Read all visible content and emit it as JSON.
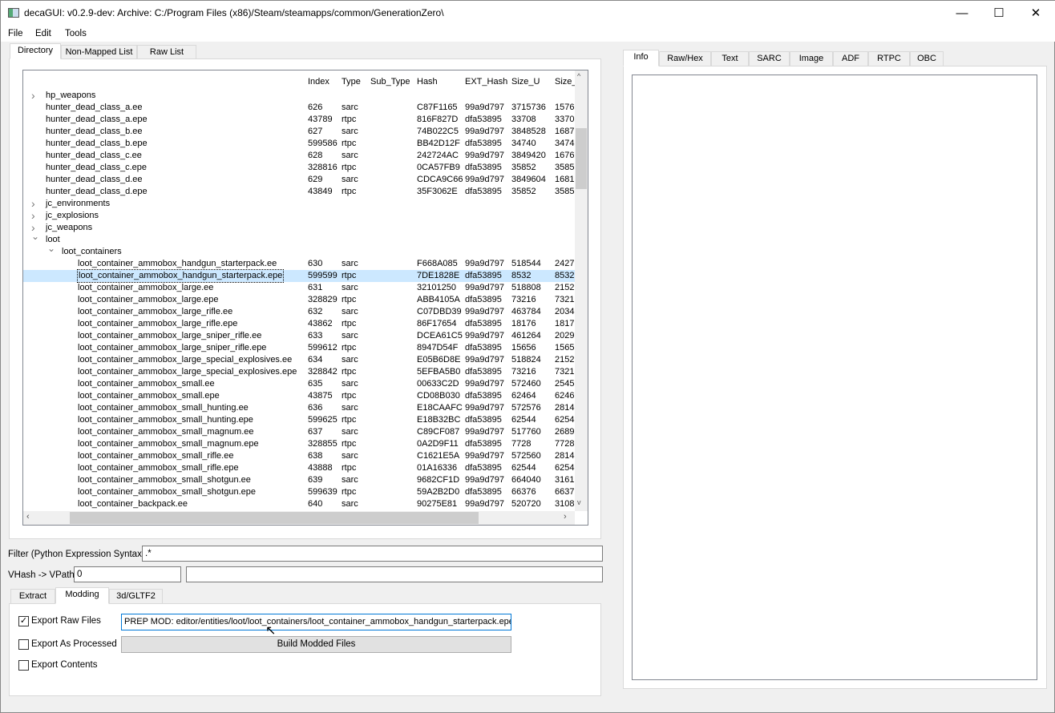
{
  "window": {
    "title": "decaGUI: v0.2.9-dev: Archive: C:/Program Files (x86)/Steam/steamapps/common/GenerationZero\\",
    "minimize": "—",
    "maximize": "☐",
    "close": "✕"
  },
  "menu": [
    "File",
    "Edit",
    "Tools"
  ],
  "left_tabs": [
    "Directory",
    "Non-Mapped List",
    "Raw List"
  ],
  "columns": [
    "Index",
    "Type",
    "Sub_Type",
    "Hash",
    "EXT_Hash",
    "Size_U",
    "Size_"
  ],
  "rows": [
    {
      "depth": 0,
      "arrow": "right",
      "name": "hp_weapons",
      "cells": []
    },
    {
      "depth": 0,
      "name": "hunter_dead_class_a.ee",
      "cells": [
        "626",
        "sarc",
        "",
        "C87F1165",
        "99a9d797",
        "3715736",
        "1576"
      ]
    },
    {
      "depth": 0,
      "name": "hunter_dead_class_a.epe",
      "cells": [
        "43789",
        "rtpc",
        "",
        "816F827D",
        "dfa53895",
        "33708",
        "3370"
      ]
    },
    {
      "depth": 0,
      "name": "hunter_dead_class_b.ee",
      "cells": [
        "627",
        "sarc",
        "",
        "74B022C5",
        "99a9d797",
        "3848528",
        "1687"
      ]
    },
    {
      "depth": 0,
      "name": "hunter_dead_class_b.epe",
      "cells": [
        "599586",
        "rtpc",
        "",
        "BB42D12F",
        "dfa53895",
        "34740",
        "3474"
      ]
    },
    {
      "depth": 0,
      "name": "hunter_dead_class_c.ee",
      "cells": [
        "628",
        "sarc",
        "",
        "242724AC",
        "99a9d797",
        "3849420",
        "1676"
      ]
    },
    {
      "depth": 0,
      "name": "hunter_dead_class_c.epe",
      "cells": [
        "328816",
        "rtpc",
        "",
        "0CA57FB9",
        "dfa53895",
        "35852",
        "3585"
      ]
    },
    {
      "depth": 0,
      "name": "hunter_dead_class_d.ee",
      "cells": [
        "629",
        "sarc",
        "",
        "CDCA9C66",
        "99a9d797",
        "3849604",
        "1681"
      ]
    },
    {
      "depth": 0,
      "name": "hunter_dead_class_d.epe",
      "cells": [
        "43849",
        "rtpc",
        "",
        "35F3062E",
        "dfa53895",
        "35852",
        "3585"
      ]
    },
    {
      "depth": 0,
      "arrow": "right",
      "name": "jc_environments",
      "cells": []
    },
    {
      "depth": 0,
      "arrow": "right",
      "name": "jc_explosions",
      "cells": []
    },
    {
      "depth": 0,
      "arrow": "right",
      "name": "jc_weapons",
      "cells": []
    },
    {
      "depth": 0,
      "arrow": "down",
      "name": "loot",
      "cells": []
    },
    {
      "depth": 1,
      "arrow": "down",
      "name": "loot_containers",
      "cells": []
    },
    {
      "depth": 2,
      "name": "loot_container_ammobox_handgun_starterpack.ee",
      "cells": [
        "630",
        "sarc",
        "",
        "F668A085",
        "99a9d797",
        "518544",
        "2427"
      ]
    },
    {
      "depth": 2,
      "selected": true,
      "name": "loot_container_ammobox_handgun_starterpack.epe",
      "cells": [
        "599599",
        "rtpc",
        "",
        "7DE1828E",
        "dfa53895",
        "8532",
        "8532"
      ]
    },
    {
      "depth": 2,
      "name": "loot_container_ammobox_large.ee",
      "cells": [
        "631",
        "sarc",
        "",
        "32101250",
        "99a9d797",
        "518808",
        "2152"
      ]
    },
    {
      "depth": 2,
      "name": "loot_container_ammobox_large.epe",
      "cells": [
        "328829",
        "rtpc",
        "",
        "ABB4105A",
        "dfa53895",
        "73216",
        "7321"
      ]
    },
    {
      "depth": 2,
      "name": "loot_container_ammobox_large_rifle.ee",
      "cells": [
        "632",
        "sarc",
        "",
        "C07DBD39",
        "99a9d797",
        "463784",
        "2034"
      ]
    },
    {
      "depth": 2,
      "name": "loot_container_ammobox_large_rifle.epe",
      "cells": [
        "43862",
        "rtpc",
        "",
        "86F17654",
        "dfa53895",
        "18176",
        "1817"
      ]
    },
    {
      "depth": 2,
      "name": "loot_container_ammobox_large_sniper_rifle.ee",
      "cells": [
        "633",
        "sarc",
        "",
        "DCEA61C5",
        "99a9d797",
        "461264",
        "2029"
      ]
    },
    {
      "depth": 2,
      "name": "loot_container_ammobox_large_sniper_rifle.epe",
      "cells": [
        "599612",
        "rtpc",
        "",
        "8947D54F",
        "dfa53895",
        "15656",
        "1565"
      ]
    },
    {
      "depth": 2,
      "name": "loot_container_ammobox_large_special_explosives.ee",
      "cells": [
        "634",
        "sarc",
        "",
        "E05B6D8E",
        "99a9d797",
        "518824",
        "2152"
      ]
    },
    {
      "depth": 2,
      "name": "loot_container_ammobox_large_special_explosives.epe",
      "cells": [
        "328842",
        "rtpc",
        "",
        "5EFBA5B0",
        "dfa53895",
        "73216",
        "7321"
      ]
    },
    {
      "depth": 2,
      "name": "loot_container_ammobox_small.ee",
      "cells": [
        "635",
        "sarc",
        "",
        "00633C2D",
        "99a9d797",
        "572460",
        "2545"
      ]
    },
    {
      "depth": 2,
      "name": "loot_container_ammobox_small.epe",
      "cells": [
        "43875",
        "rtpc",
        "",
        "CD08B030",
        "dfa53895",
        "62464",
        "6246"
      ]
    },
    {
      "depth": 2,
      "name": "loot_container_ammobox_small_hunting.ee",
      "cells": [
        "636",
        "sarc",
        "",
        "E18CAAFC",
        "99a9d797",
        "572576",
        "2814"
      ]
    },
    {
      "depth": 2,
      "name": "loot_container_ammobox_small_hunting.epe",
      "cells": [
        "599625",
        "rtpc",
        "",
        "E18B32BC",
        "dfa53895",
        "62544",
        "6254"
      ]
    },
    {
      "depth": 2,
      "name": "loot_container_ammobox_small_magnum.ee",
      "cells": [
        "637",
        "sarc",
        "",
        "C89CF087",
        "99a9d797",
        "517760",
        "2689"
      ]
    },
    {
      "depth": 2,
      "name": "loot_container_ammobox_small_magnum.epe",
      "cells": [
        "328855",
        "rtpc",
        "",
        "0A2D9F11",
        "dfa53895",
        "7728",
        "7728"
      ]
    },
    {
      "depth": 2,
      "name": "loot_container_ammobox_small_rifle.ee",
      "cells": [
        "638",
        "sarc",
        "",
        "C1621E5A",
        "99a9d797",
        "572560",
        "2814"
      ]
    },
    {
      "depth": 2,
      "name": "loot_container_ammobox_small_rifle.epe",
      "cells": [
        "43888",
        "rtpc",
        "",
        "01A16336",
        "dfa53895",
        "62544",
        "6254"
      ]
    },
    {
      "depth": 2,
      "name": "loot_container_ammobox_small_shotgun.ee",
      "cells": [
        "639",
        "sarc",
        "",
        "9682CF1D",
        "99a9d797",
        "664040",
        "3161"
      ]
    },
    {
      "depth": 2,
      "name": "loot_container_ammobox_small_shotgun.epe",
      "cells": [
        "599639",
        "rtpc",
        "",
        "59A2B2D0",
        "dfa53895",
        "66376",
        "6637"
      ]
    },
    {
      "depth": 2,
      "name": "loot_container_backpack.ee",
      "cells": [
        "640",
        "sarc",
        "",
        "90275E81",
        "99a9d797",
        "520720",
        "3108"
      ]
    }
  ],
  "filter": {
    "label": "Filter (Python Expression Syntax)",
    "value": ".*"
  },
  "vhash": {
    "label": "VHash -> VPath",
    "value": "0",
    "result": ""
  },
  "bottom_tabs": [
    "Extract",
    "Modding",
    "3d/GLTF2"
  ],
  "modding": {
    "export_raw": {
      "label": "Export Raw Files",
      "checked": true
    },
    "export_processed": {
      "label": "Export As Processed",
      "checked": false
    },
    "export_contents": {
      "label": "Export Contents",
      "checked": false
    },
    "status": "PREP MOD: editor/entities/loot/loot_containers/loot_container_ammobox_handgun_starterpack.epe",
    "build_label": "Build Modded Files"
  },
  "right_tabs": [
    "Info",
    "Raw/Hex",
    "Text",
    "SARC",
    "Image",
    "ADF",
    "RTPC",
    "OBC"
  ],
  "colors": {
    "selection": "#cce8ff",
    "focus": "#0078d7"
  }
}
